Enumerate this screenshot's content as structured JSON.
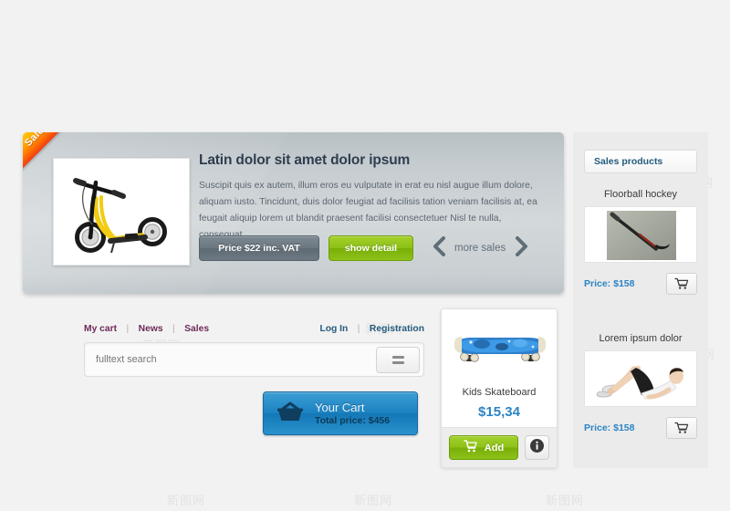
{
  "page": {
    "background": "#f2f2f2",
    "watermark_text": "新图网"
  },
  "hero": {
    "ribbon_label": "Sale",
    "title": "Latin dolor sit amet dolor ipsum",
    "body": "Suscipit quis ex autem, illum eros eu vulputate in erat eu nisl augue illum dolore, aliquam iusto. Tincidunt, duis dolor feugiat ad facilisis tation veniam facilisis at, ea feugait aliquip lorem ut blandit praesent facilisi consectetuer Nisl te nulla, consequat",
    "price_button": "Price $22 inc. VAT",
    "detail_button": "show detail",
    "more_sales_label": "more sales",
    "prev_icon": "chevron-left-icon",
    "next_icon": "chevron-right-icon",
    "image_alt": "yellow kick scooter",
    "accent_green": "#8cc017",
    "accent_gray": "#6b7780"
  },
  "nav": {
    "left": [
      {
        "label": "My cart"
      },
      {
        "label": "News"
      },
      {
        "label": "Sales"
      }
    ],
    "right": [
      {
        "label": "Log In"
      },
      {
        "label": "Registration"
      }
    ],
    "separator": "|",
    "left_color": "#6e2a57",
    "right_color": "#245c7d"
  },
  "search": {
    "placeholder": "fulltext search",
    "value": "",
    "button_icon": "list-lines-icon"
  },
  "cart": {
    "icon": "shopping-basket-icon",
    "title": "Your Cart",
    "total_label": "Total price: $456",
    "color": "#1c83c2"
  },
  "product_card": {
    "image_alt": "blue kids skateboard",
    "name": "Kids Skateboard",
    "price": "$15,34",
    "price_color": "#2a84c4",
    "add_button": "Add",
    "add_icon": "shopping-cart-icon",
    "info_icon": "info-circle-icon"
  },
  "sidebar": {
    "header": "Sales products",
    "items": [
      {
        "name": "Floorball hockey",
        "price": "Price: $158",
        "cart_icon": "shopping-cart-icon",
        "image_alt": "floorball hockey stick"
      },
      {
        "name": "Lorem ipsum dolor",
        "price": "Price: $158",
        "cart_icon": "shopping-cart-icon",
        "image_alt": "person doing sit-ups exercise"
      }
    ]
  }
}
